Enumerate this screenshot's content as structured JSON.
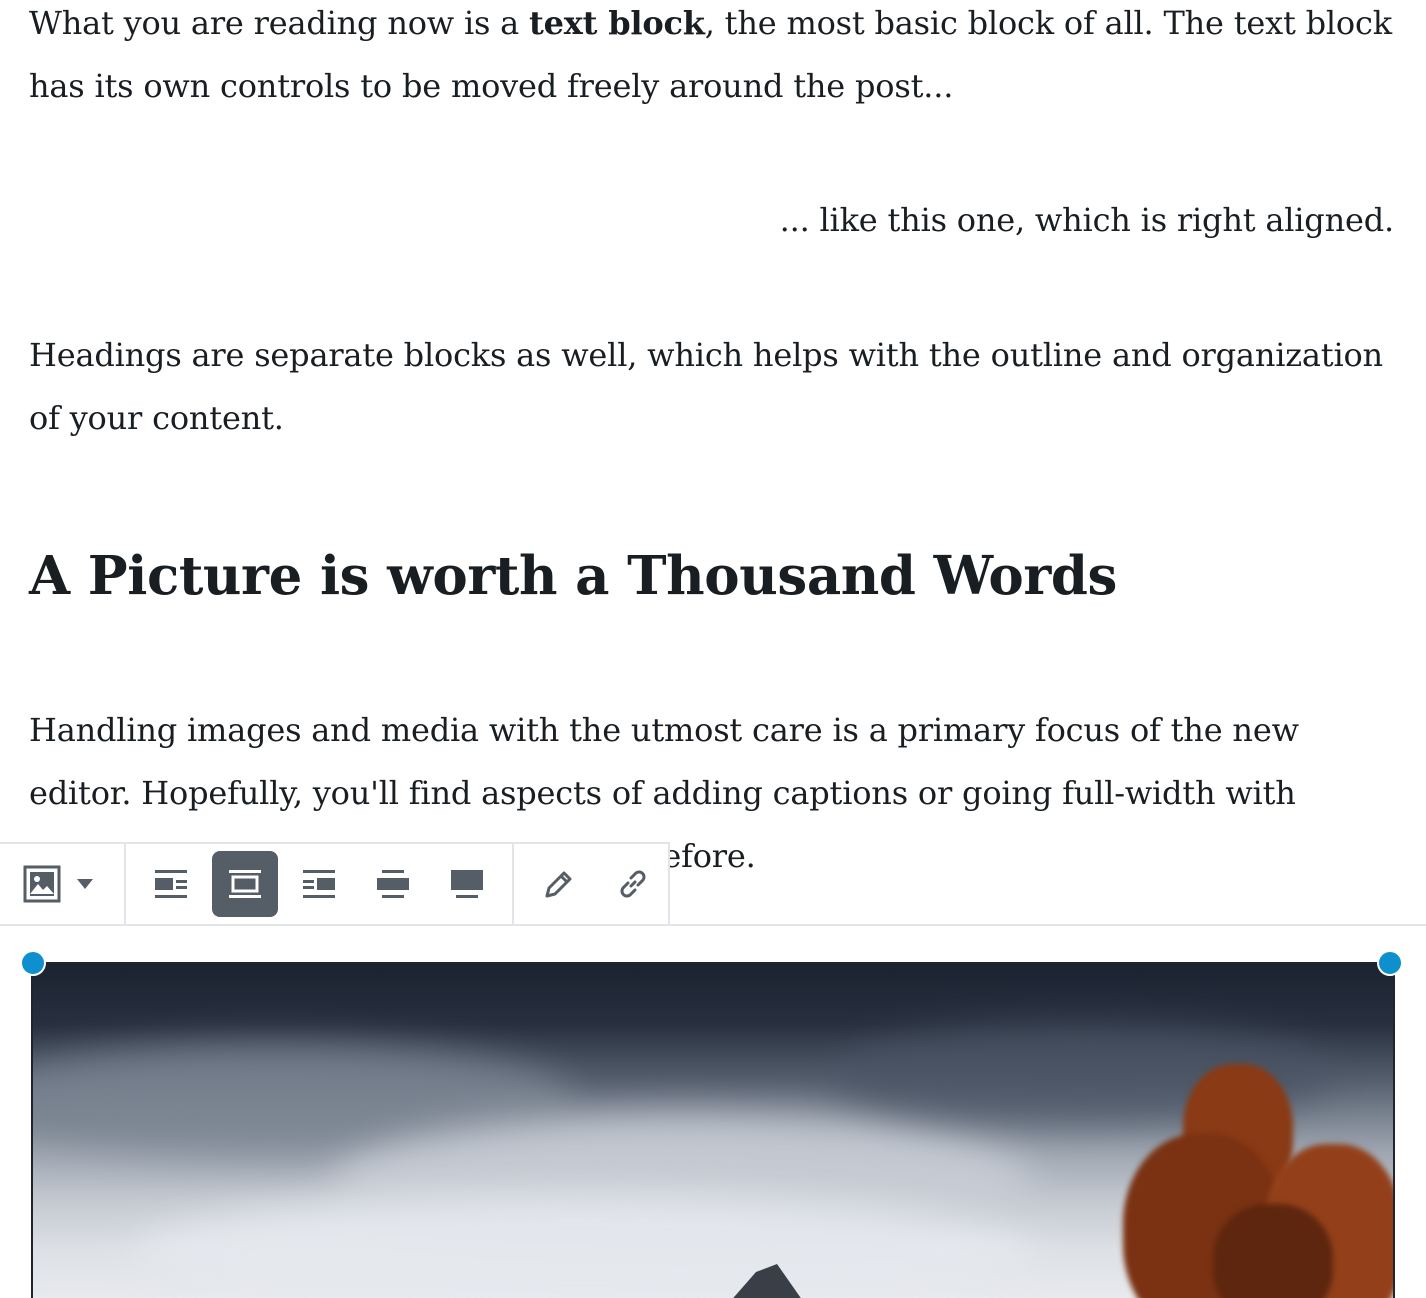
{
  "paragraphs": {
    "p1_before": "What you are reading now is a ",
    "p1_bold": "text block",
    "p1_after": ", the most basic block of all. The text block has its own controls to be moved freely around the post...",
    "p2": "... like this one, which is right aligned.",
    "p3": "Headings are separate blocks as well, which helps with the outline and organization of your content.",
    "p4": "Handling images and media with the utmost care is a primary focus of the new editor. Hopefully, you'll find aspects of adding captions or going full-width with pictures much easier and robust than before."
  },
  "heading": "A Picture is worth a Thousand Words",
  "toolbar": {
    "block_type_icon": "image-icon",
    "alignment_buttons": [
      "align-left-icon",
      "align-center-icon",
      "align-right-icon",
      "align-wide-icon",
      "align-full-icon"
    ],
    "active_alignment": "align-center-icon",
    "edit_icon": "pencil-icon",
    "link_icon": "link-icon"
  },
  "colors": {
    "text": "#191e23",
    "toolbar_border": "#e2e4e7",
    "active_button": "#555d66",
    "handle": "#0e8fce"
  }
}
